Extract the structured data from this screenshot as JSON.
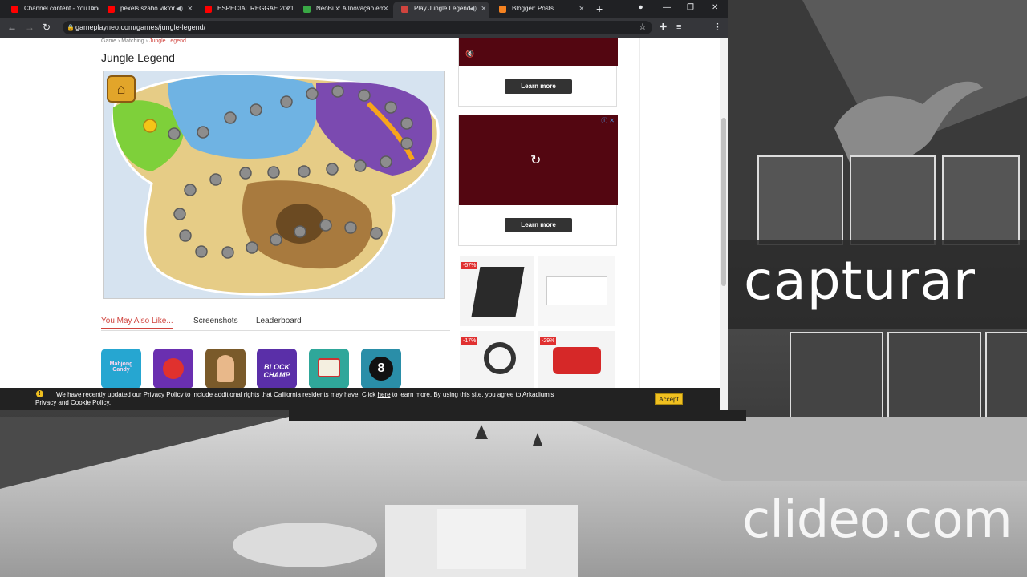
{
  "browser": {
    "tabs": [
      {
        "label": "Channel content - YouTube",
        "color": "#ff0000"
      },
      {
        "label": "pexels szabó viktor",
        "color": "#ff0000"
      },
      {
        "label": "ESPECIAL REGGAE 2021",
        "color": "#ff0000"
      },
      {
        "label": "NeoBux: A Inovação em",
        "color": "#39a845"
      },
      {
        "label": "Play Jungle Legend",
        "color": "#d0443e"
      },
      {
        "label": "Blogger: Posts",
        "color": "#f58220"
      }
    ],
    "url": "gameplayneo.com/games/jungle-legend/"
  },
  "page": {
    "breadcrumb": {
      "game": "Game",
      "matching": "Matching",
      "current": "Jungle Legend"
    },
    "title": "Jungle Legend",
    "tabs": {
      "like": "You May Also Like...",
      "screenshots": "Screenshots",
      "leaderboard": "Leaderboard"
    },
    "related_games": [
      {
        "label": "Mahjong Candy",
        "color": "#26a6d1"
      },
      {
        "label": "",
        "color": "#6a2fb0"
      },
      {
        "label": "",
        "color": "#7a5a2a"
      },
      {
        "label": "BLOCK CHAMP",
        "color": "#5a2fa8"
      },
      {
        "label": "",
        "color": "#2fa79a"
      },
      {
        "label": "8",
        "color": "#2a8ea8"
      }
    ]
  },
  "ads": {
    "learn_more_1": "Learn more",
    "learn_more_2": "Learn more",
    "discount_1": "-57%",
    "discount_2": "-17%",
    "discount_3": "-29%"
  },
  "cookie": {
    "text_before": "We have recently updated our Privacy Policy to include additional rights that California residents may have. Click ",
    "here": "here",
    "text_after": " to learn more. By using this site, you agree to Arkadium's",
    "policy_link": "Privacy and Cookie Policy.",
    "accept": "Accept"
  },
  "overlay": {
    "caption": "capturar",
    "watermark": "clideo.com"
  }
}
